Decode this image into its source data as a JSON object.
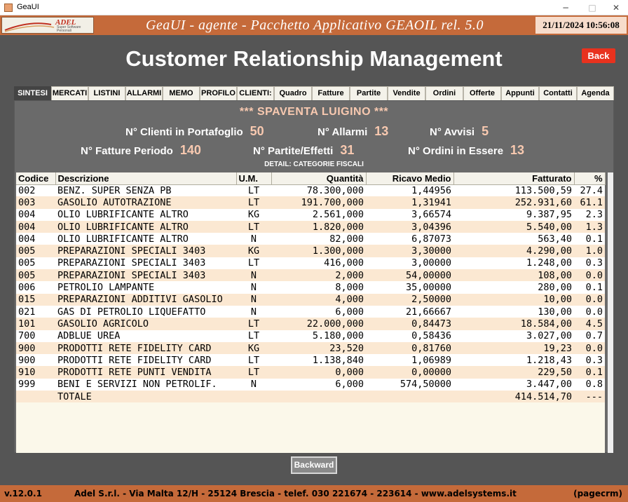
{
  "window": {
    "title": "GeaUI"
  },
  "header": {
    "logo_text": "ADEL",
    "logo_sub": "Super Software Personali",
    "title": "GeaUI - agente - Pacchetto Applicativo GEAOIL rel. 5.0",
    "datetime": "21/11/2024 10:56:08"
  },
  "page_title": "Customer Relationship Management",
  "back_label": "Back",
  "tabs": [
    {
      "label": "SINTESI",
      "active": true
    },
    {
      "label": "MERCATI"
    },
    {
      "label": "LISTINI"
    },
    {
      "label": "ALLARMI"
    },
    {
      "label": "MEMO"
    },
    {
      "label": "PROFILO"
    },
    {
      "label": "CLIENTI:"
    },
    {
      "label": "Quadro"
    },
    {
      "label": "Fatture"
    },
    {
      "label": "Partite"
    },
    {
      "label": "Vendite"
    },
    {
      "label": "Ordini"
    },
    {
      "label": "Offerte"
    },
    {
      "label": "Appunti"
    },
    {
      "label": "Contatti"
    },
    {
      "label": "Agenda"
    }
  ],
  "agent": {
    "name": "*** SPAVENTA LUIGINO ***"
  },
  "stats": {
    "clienti_label": "N° Clienti in Portafoglio",
    "clienti_value": "50",
    "allarmi_label": "N° Allarmi",
    "allarmi_value": "13",
    "avvisi_label": "N° Avvisi",
    "avvisi_value": "5",
    "fatture_label": "N° Fatture Periodo",
    "fatture_value": "140",
    "partite_label": "N° Partite/Effetti",
    "partite_value": "31",
    "ordini_label": "N° Ordini in Essere",
    "ordini_value": "13"
  },
  "detail": {
    "title": "DETAIL: CATEGORIE FISCALI",
    "columns": [
      "Codice",
      "Descrizione",
      "U.M.",
      "Quantità",
      "Ricavo Medio",
      "Fatturato",
      "%"
    ],
    "rows": [
      [
        "002",
        "BENZ. SUPER SENZA PB",
        "LT",
        "78.300,000",
        "1,44956",
        "113.500,59",
        "27.4"
      ],
      [
        "003",
        "GASOLIO AUTOTRAZIONE",
        "LT",
        "191.700,000",
        "1,31941",
        "252.931,60",
        "61.1"
      ],
      [
        "004",
        "OLIO LUBRIFICANTE ALTRO",
        "KG",
        "2.561,000",
        "3,66574",
        "9.387,95",
        "2.3"
      ],
      [
        "004",
        "OLIO LUBRIFICANTE ALTRO",
        "LT",
        "1.820,000",
        "3,04396",
        "5.540,00",
        "1.3"
      ],
      [
        "004",
        "OLIO LUBRIFICANTE ALTRO",
        "N",
        "82,000",
        "6,87073",
        "563,40",
        "0.1"
      ],
      [
        "005",
        "PREPARAZIONI SPECIALI 3403",
        "KG",
        "1.300,000",
        "3,30000",
        "4.290,00",
        "1.0"
      ],
      [
        "005",
        "PREPARAZIONI SPECIALI 3403",
        "LT",
        "416,000",
        "3,00000",
        "1.248,00",
        "0.3"
      ],
      [
        "005",
        "PREPARAZIONI SPECIALI 3403",
        "N",
        "2,000",
        "54,00000",
        "108,00",
        "0.0"
      ],
      [
        "006",
        "PETROLIO LAMPANTE",
        "N",
        "8,000",
        "35,00000",
        "280,00",
        "0.1"
      ],
      [
        "015",
        "PREPARAZIONI ADDITIVI GASOLIO",
        "N",
        "4,000",
        "2,50000",
        "10,00",
        "0.0"
      ],
      [
        "021",
        "GAS DI PETROLIO LIQUEFATTO",
        "N",
        "6,000",
        "21,66667",
        "130,00",
        "0.0"
      ],
      [
        "101",
        "GASOLIO AGRICOLO",
        "LT",
        "22.000,000",
        "0,84473",
        "18.584,00",
        "4.5"
      ],
      [
        "700",
        "ADBLUE UREA",
        "LT",
        "5.180,000",
        "0,58436",
        "3.027,00",
        "0.7"
      ],
      [
        "900",
        "PRODOTTI RETE FIDELITY CARD",
        "KG",
        "23,520",
        "0,81760",
        "19,23",
        "0.0"
      ],
      [
        "900",
        "PRODOTTI RETE FIDELITY CARD",
        "LT",
        "1.138,840",
        "1,06989",
        "1.218,43",
        "0.3"
      ],
      [
        "910",
        "PRODOTTI RETE PUNTI VENDITA",
        "LT",
        "0,000",
        "0,00000",
        "229,50",
        "0.1"
      ],
      [
        "999",
        "BENI E SERVIZI NON PETROLIF.",
        "N",
        "6,000",
        "574,50000",
        "3.447,00",
        "0.8"
      ],
      [
        "",
        "TOTALE",
        "",
        "",
        "",
        "414.514,70",
        "---"
      ]
    ]
  },
  "backward_label": "Backward",
  "footer": {
    "version": "v.12.0.1",
    "address": "Adel S.r.l. - Via Malta 12/H - 25124 Brescia - telef. 030 221674 - 223614 - www.adelsystems.it",
    "page": "(pagecrm)"
  }
}
